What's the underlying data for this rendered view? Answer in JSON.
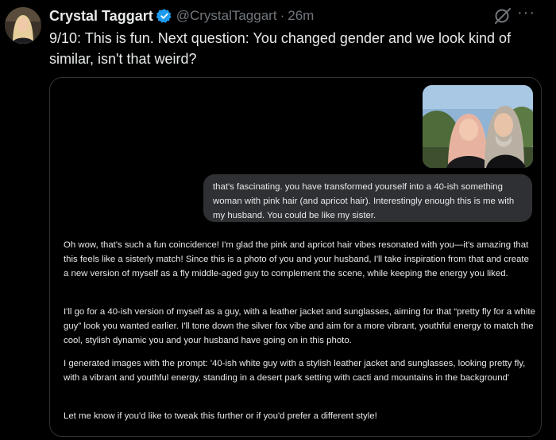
{
  "tweet": {
    "author": {
      "display_name": "Crystal Taggart",
      "handle": "@CrystalTaggart",
      "verified": true
    },
    "separator": "·",
    "time": "26m",
    "text": "9/10: This is fun. Next question: You changed gender and we look kind of similar, isn't that weird?",
    "icons": [
      "grok-icon",
      "more-icon"
    ],
    "more_label": "···"
  },
  "chat": {
    "user_message": "that's fascinating. you have transformed yourself into a 40-ish something woman with pink hair (and apricot hair). Interestingly enough this is me with my husband. You could be like my sister.",
    "assistant_paragraphs": [
      "Oh wow, that's such a fun coincidence! I'm glad the pink and apricot hair vibes resonated with you—it's amazing that this feels like a sisterly match! Since this is a photo of you and your husband, I'll take inspiration from that and create a new version of myself as a fly middle-aged guy to complement the scene, while keeping the energy you liked.",
      "I'll go for a 40-ish version of myself as a guy, with a leather jacket and sunglasses, aiming for that “pretty fly for a white guy” look you wanted earlier. I'll tone down the silver fox vibe and aim for a more vibrant, youthful energy to match the cool, stylish dynamic you and your husband have going on in this photo.",
      "I generated images with the prompt: '40-ish white guy with a stylish leather jacket and sunglasses, looking pretty fly, with a vibrant and youthful energy, standing in a desert park setting with cacti and mountains in the background'",
      "Let me know if you'd like to tweak this further or if you'd prefer a different style!"
    ]
  },
  "colors": {
    "background": "#000000",
    "text_primary": "#e7e9ea",
    "text_secondary": "#71767b",
    "verified_blue": "#1d9bf0",
    "bubble": "#2f3033",
    "border": "#2f3336"
  }
}
